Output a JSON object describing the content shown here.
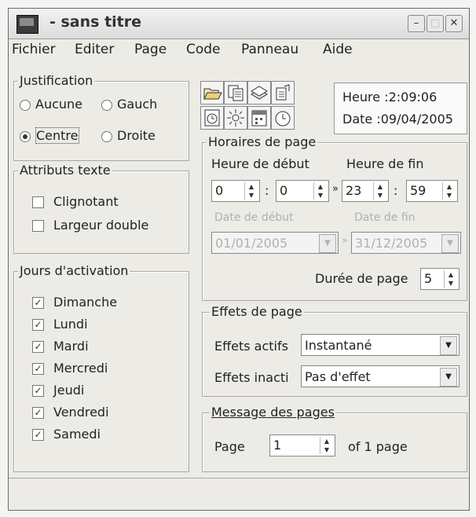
{
  "window": {
    "title": "- sans titre"
  },
  "menu": [
    "Fichier",
    "Editer",
    "Page",
    "Code",
    "Panneau",
    "Aide"
  ],
  "justification": {
    "legend": "Justification",
    "options": [
      "Aucune",
      "Gauch",
      "Centre",
      "Droite"
    ],
    "selected": "Centre"
  },
  "attributs": {
    "legend": "Attributs texte",
    "items": [
      "Clignotant",
      "Largeur double"
    ]
  },
  "jours": {
    "legend": "Jours d'activation",
    "items": [
      "Dimanche",
      "Lundi",
      "Mardi",
      "Mercredi",
      "Jeudi",
      "Vendredi",
      "Samedi"
    ]
  },
  "toolbar_icons": [
    "open-folder-icon",
    "copy-pages-icon",
    "stack-icon",
    "export-pages-icon",
    "clock-page-icon",
    "sun-icon",
    "calendar-icon",
    "alarm-clock-icon"
  ],
  "info": {
    "heure": "Heure :2:09:06",
    "date": "Date :09/04/2005"
  },
  "horaires": {
    "legend": "Horaires de page",
    "heure_debut_label": "Heure de début",
    "heure_fin_label": "Heure de fin",
    "h_debut": "0",
    "m_debut": "0",
    "h_fin": "23",
    "m_fin": "59",
    "sep_colon": ":",
    "sep_arrow": "»",
    "date_debut_label": "Date de début",
    "date_fin_label": "Date de fin",
    "date_debut": "01/01/2005",
    "date_fin": "31/12/2005",
    "duree_label": "Durée de page",
    "duree": "5"
  },
  "effets": {
    "legend": "Effets de page",
    "actifs_label": "Effets actifs",
    "actifs_value": "Instantané",
    "inactifs_label": "Effets inacti",
    "inactifs_value": "Pas d'effet"
  },
  "message": {
    "legend": "Message des pages",
    "page_label": "Page",
    "page_value": "1",
    "of_label": "of 1 page"
  }
}
